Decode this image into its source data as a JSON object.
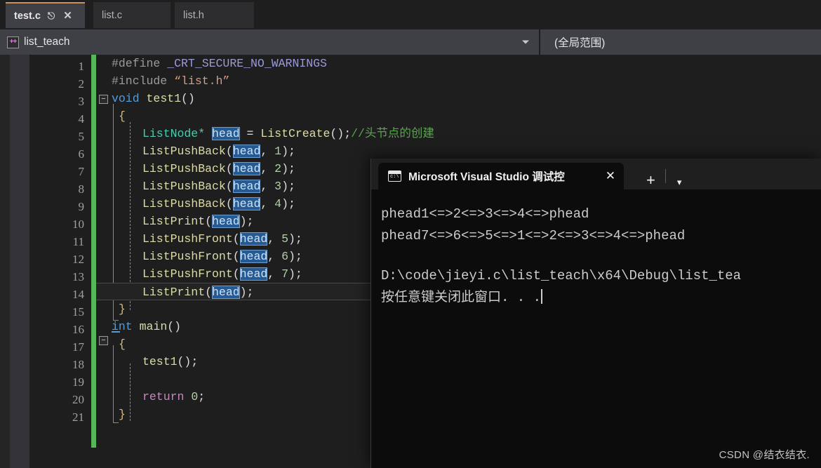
{
  "editor_tabs": [
    {
      "label": "test.c",
      "active": true,
      "pin_icon": "pin-icon",
      "close_icon": "close-icon"
    },
    {
      "label": "list.c",
      "active": false
    },
    {
      "label": "list.h",
      "active": false
    }
  ],
  "navbar": {
    "project_icon": "cpp-project-icon",
    "project_icon_text": "++",
    "project_name": "list_teach",
    "dropdown_icon": "chevron-down-icon",
    "scope_label": "(全局范围)"
  },
  "code": {
    "line_numbers": [
      "1",
      "2",
      "3",
      "4",
      "5",
      "6",
      "7",
      "8",
      "9",
      "10",
      "11",
      "12",
      "13",
      "14",
      "15",
      "16",
      "17",
      "18",
      "19",
      "20",
      "21"
    ],
    "current_line": 14,
    "lines": [
      {
        "n": 1,
        "text": "#define _CRT_SECURE_NO_WARNINGS"
      },
      {
        "n": 2,
        "text": "#include “list.h”"
      },
      {
        "n": 3,
        "text": "void test1()"
      },
      {
        "n": 4,
        "text": "{"
      },
      {
        "n": 5,
        "text": "ListNode* head = ListCreate();//头节点的创建"
      },
      {
        "n": 6,
        "text": "ListPushBack(head, 1);"
      },
      {
        "n": 7,
        "text": "ListPushBack(head, 2);"
      },
      {
        "n": 8,
        "text": "ListPushBack(head, 3);"
      },
      {
        "n": 9,
        "text": "ListPushBack(head, 4);"
      },
      {
        "n": 10,
        "text": "ListPrint(head);"
      },
      {
        "n": 11,
        "text": "ListPushFront(head, 5);"
      },
      {
        "n": 12,
        "text": "ListPushFront(head, 6);"
      },
      {
        "n": 13,
        "text": "ListPushFront(head, 7);"
      },
      {
        "n": 14,
        "text": "ListPrint(head);"
      },
      {
        "n": 15,
        "text": "}"
      },
      {
        "n": 16,
        "text": "int main()"
      },
      {
        "n": 17,
        "text": "{"
      },
      {
        "n": 18,
        "text": "test1();"
      },
      {
        "n": 19,
        "text": ""
      },
      {
        "n": 20,
        "text": "return 0;"
      },
      {
        "n": 21,
        "text": "}"
      }
    ],
    "tokens": {
      "define_directive": "#define",
      "macro_name": " _CRT_SECURE_NO_WARNINGS",
      "include_directive": "#include",
      "include_path": " “list.h”",
      "kw_void": "void",
      "fn_test1": "test1",
      "kw_int": "int",
      "fn_main": "main",
      "kw_return": "return",
      "type_listnode": "ListNode*",
      "var_head": "head",
      "fn_listcreate": "ListCreate",
      "fn_listpushback": "ListPushBack",
      "fn_listpushfront": "ListPushFront",
      "fn_listprint": "ListPrint",
      "comment_head_create": "//头节点的创建",
      "brace_open": "{",
      "brace_close": "}",
      "paren_open": "(",
      "paren_close": ")",
      "paren_pair": "()",
      "semicolon": ";",
      "comma_sp": ", ",
      "assign": " = ",
      "space": " ",
      "num_0": "0",
      "num_1": "1",
      "num_2": "2",
      "num_3": "3",
      "num_4": "4",
      "num_5": "5",
      "num_6": "6",
      "num_7": "7",
      "fold_glyph": "−"
    },
    "colors": {
      "background": "#1e1e1e",
      "changed_bar": "#57b65a",
      "gutter": "#333337",
      "keyword": "#569cd6",
      "type": "#4ec9b0",
      "function": "#dcdcaa",
      "number": "#b5cea8",
      "comment": "#57a64a",
      "string": "#d69d85",
      "macro": "#9a9ad6",
      "highlight_bg": "#265a93"
    }
  },
  "terminal": {
    "tab": {
      "icon": "console-icon",
      "icon_text": "c:\\",
      "title": "Microsoft Visual Studio 调试控",
      "close_icon": "close-icon"
    },
    "newtab_icon": "plus-icon",
    "dropdown_icon": "chevron-down-icon",
    "output": {
      "line1": "phead1<=>2<=>3<=>4<=>phead",
      "line2": "phead7<=>6<=>5<=>1<=>2<=>3<=>4<=>phead",
      "path_line": "D:\\code\\jieyi.c\\list_teach\\x64\\Debug\\list_tea",
      "prompt_line": "按任意键关闭此窗口. . ."
    },
    "colors": {
      "background": "#0c0c0c",
      "titlebar": "#1f1f1f",
      "text": "#cccccc"
    }
  },
  "watermark": {
    "text": "CSDN @结衣结衣."
  }
}
